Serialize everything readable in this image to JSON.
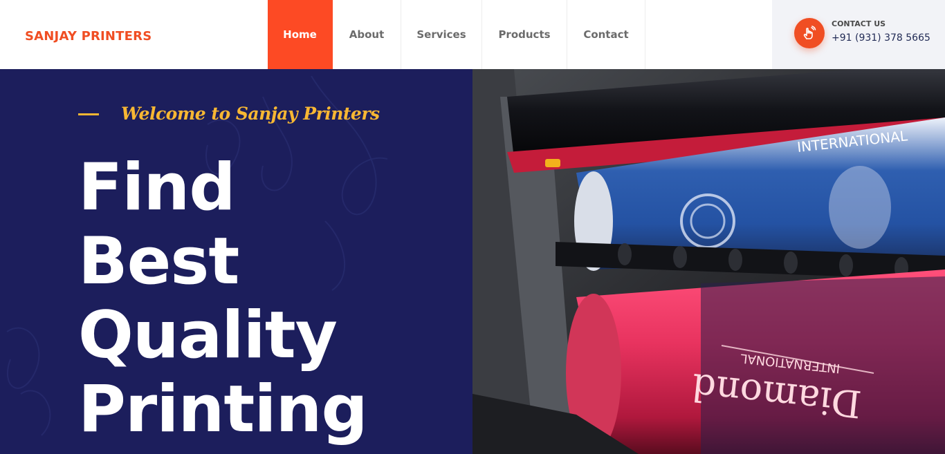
{
  "brand": {
    "name": "SANJAY PRINTERS"
  },
  "nav": {
    "items": [
      {
        "label": "Home",
        "active": true
      },
      {
        "label": "About",
        "active": false
      },
      {
        "label": "Services",
        "active": false
      },
      {
        "label": "Products",
        "active": false
      },
      {
        "label": "Contact",
        "active": false
      }
    ]
  },
  "contact": {
    "label": "CONTACT US",
    "phone": "+91 (931) 378 5665",
    "icon": "hand-phone-icon"
  },
  "hero": {
    "welcome": "Welcome to Sanjay Printers",
    "title_lines": [
      "Find",
      "Best",
      "Quality",
      "Printing"
    ],
    "image_text": {
      "top_roller": "INTERNATIONAL",
      "bottom_roller_brand": "Diamond",
      "bottom_roller_sub": "INTERNATIONAL"
    }
  },
  "colors": {
    "accent": "#fd4a24",
    "brand": "#f04e23",
    "hero_bg": "#1c1e5c",
    "welcome": "#f7b733"
  }
}
